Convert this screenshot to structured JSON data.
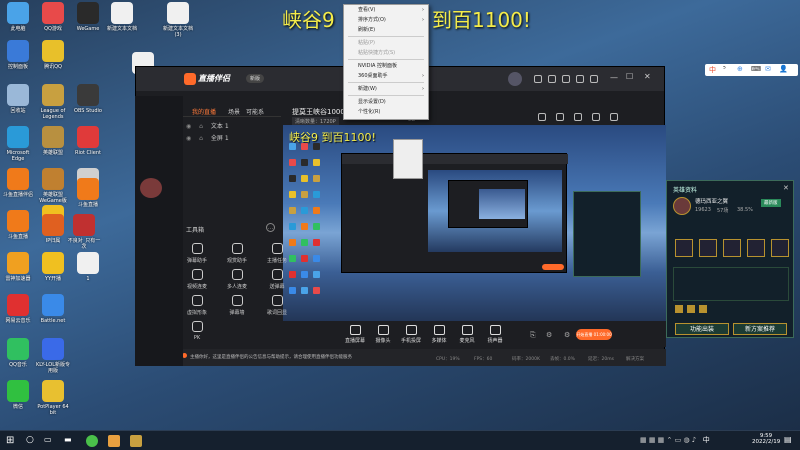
{
  "desktop": {
    "icons": [
      {
        "label": "此电脑",
        "color": "#4aa3e8"
      },
      {
        "label": "QQ游戏",
        "color": "#e84a4a"
      },
      {
        "label": "WeGame",
        "color": "#2a2a2a"
      },
      {
        "label": "新建文本文档",
        "color": "#f0f0f0"
      },
      {
        "label": "新建文本文档 (3)",
        "color": "#f0f0f0"
      },
      {
        "label": "控制面板",
        "color": "#3a7ad8"
      },
      {
        "label": "腾讯QQ",
        "color": "#e8c02a"
      },
      {
        "label": "1",
        "color": "#f0f0f0"
      },
      {
        "label": "回收站",
        "color": "#9ab8d8"
      },
      {
        "label": "League of Legends",
        "color": "#c8a040"
      },
      {
        "label": "OBS Studio",
        "color": "#3a3a3a"
      },
      {
        "label": "Microsoft Edge",
        "color": "#2a9ad8"
      },
      {
        "label": "英雄联盟",
        "color": "#b89040"
      },
      {
        "label": "Riot Client",
        "color": "#e03a3a"
      },
      {
        "label": "斗鱼直播伴侣",
        "color": "#f07a1a"
      },
      {
        "label": "英雄联盟 WeGame版",
        "color": "#c08030"
      },
      {
        "label": "丰科蓝-1",
        "color": "#d0d0d0"
      },
      {
        "label": "斗鱼直播",
        "color": "#f07a1a"
      },
      {
        "label": "YY开播",
        "color": "#f0c020"
      },
      {
        "label": "斗鱼直播",
        "color": "#f07a1a"
      },
      {
        "label": "IP归属",
        "color": "#e06020"
      },
      {
        "label": "不良对_只有一次",
        "color": "#c03030"
      },
      {
        "label": "雷神加速器",
        "color": "#f0a020"
      },
      {
        "label": "YY开播",
        "color": "#f0c020"
      },
      {
        "label": "1",
        "color": "#f0f0f0"
      },
      {
        "label": "网易云音乐",
        "color": "#e03030"
      },
      {
        "label": "Battle.net",
        "color": "#3a8ae8"
      },
      {
        "label": "QQ音乐",
        "color": "#30c060"
      },
      {
        "label": "KLY-LOL新版专用版",
        "color": "#3a6ae8"
      },
      {
        "label": "微信",
        "color": "#30c040"
      },
      {
        "label": "PotPlayer 64 bit",
        "color": "#e8c030"
      }
    ]
  },
  "overlay_title": "峡谷9",
  "overlay_title_rest": "到百1100!",
  "context_menu": {
    "items": [
      {
        "label": "查看(V)",
        "disabled": false,
        "arrow": true
      },
      {
        "label": "排序方式(O)",
        "disabled": false,
        "arrow": true
      },
      {
        "label": "刷新(E)",
        "disabled": false,
        "arrow": false
      },
      {
        "sep": true
      },
      {
        "label": "粘贴(P)",
        "disabled": true,
        "arrow": false
      },
      {
        "label": "粘贴快捷方式(S)",
        "disabled": true,
        "arrow": false
      },
      {
        "sep": true
      },
      {
        "label": "NVIDIA 控制面板",
        "disabled": false,
        "arrow": false
      },
      {
        "label": "360桌面助手",
        "disabled": false,
        "arrow": true
      },
      {
        "sep": true
      },
      {
        "label": "新建(W)",
        "disabled": false,
        "arrow": true
      },
      {
        "sep": true
      },
      {
        "label": "显示设置(D)",
        "disabled": false,
        "arrow": false
      },
      {
        "label": "个性化(R)",
        "disabled": false,
        "arrow": false
      }
    ]
  },
  "app": {
    "logo": "直播伴侣",
    "version_badge": "新版",
    "tabs": [
      "我的直播",
      "场景",
      "可能系"
    ],
    "stream_title": "提莫王峡谷1000场到百1100!",
    "stream_sub1": "清晰数量：1720P",
    "stream_sub2": "5G",
    "scene_items": [
      "文本 1",
      "全屏 1"
    ],
    "tools_header": "工具箱",
    "tools": [
      [
        "弹幕助手",
        "观赏助手",
        "主播任务"
      ],
      [
        "视频连麦",
        "多人连麦",
        "送弹幕"
      ],
      [
        "虚拟形象",
        "弹幕墙",
        "歌词回显"
      ],
      [
        "PK",
        "",
        ""
      ]
    ],
    "controls": [
      "直播屏幕",
      "摄像头",
      "手机投屏",
      "多媒体",
      "麦克风",
      "扬声器"
    ],
    "go_live": "开始直播 01:00:00",
    "notice": "主播你好，这里是直播伴侣的公告信息与帮助提示，请合理使用直播伴侣功能服务",
    "status_items": [
      "CPU：19%",
      "FPS：60",
      "码率：2000K",
      "丢帧：0.0%",
      "延迟：20ms",
      "解决方案"
    ],
    "preview_title": "峡谷9 到百1100!"
  },
  "side_panel": {
    "title": "英雄资料",
    "champion": "德玛西亚之翼",
    "stat1": "19623",
    "stat2": "57场",
    "stat3": "38.5%",
    "tag": "最新版",
    "buttons": [
      "功能出装",
      "新方案推荐"
    ]
  },
  "taskbar": {
    "time": "9:59",
    "date": "2022/2/19",
    "lang": "中"
  },
  "ime": {
    "items": [
      "中",
      "⁵",
      "⊕",
      "⌨",
      "✉",
      "👤"
    ]
  }
}
